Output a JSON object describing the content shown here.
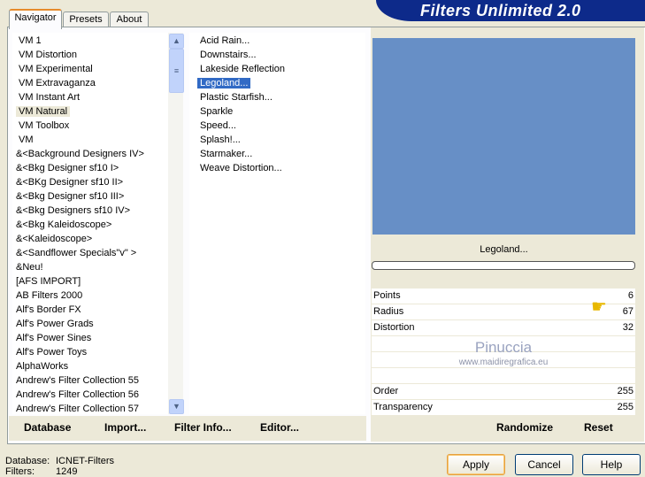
{
  "app_title": "Filters Unlimited 2.0",
  "tabs": [
    {
      "label": "Navigator"
    },
    {
      "label": "Presets"
    },
    {
      "label": "About"
    }
  ],
  "categories": [
    "VM 1",
    "VM Distortion",
    "VM Experimental",
    "VM Extravaganza",
    "VM Instant Art",
    "VM Natural",
    "VM Toolbox",
    "VM",
    "&<Background Designers IV>",
    "&<Bkg Designer sf10 I>",
    "&<BKg Designer sf10 II>",
    "&<Bkg Designer sf10 III>",
    "&<Bkg Designers sf10 IV>",
    "&<Bkg Kaleidoscope>",
    "&<Kaleidoscope>",
    "&<Sandflower Specials\"v\" >",
    "&Neu!",
    "[AFS IMPORT]",
    "AB Filters 2000",
    "Alf's Border FX",
    "Alf's Power Grads",
    "Alf's Power Sines",
    "Alf's Power Toys",
    "AlphaWorks",
    "Andrew's Filter Collection 55",
    "Andrew's Filter Collection 56",
    "Andrew's Filter Collection 57"
  ],
  "selected_category": "VM Natural",
  "filters": [
    "Acid Rain...",
    "Downstairs...",
    "Lakeside Reflection",
    "Legoland...",
    "Plastic Starfish...",
    "Sparkle",
    "Speed...",
    "Splash!...",
    "Starmaker...",
    "Weave Distortion..."
  ],
  "selected_filter": "Legoland...",
  "bottom_buttons": {
    "database": "Database",
    "import": "Import...",
    "filter_info": "Filter Info...",
    "editor": "Editor..."
  },
  "preview": {
    "color": "#678fc6",
    "filter_name": "Legoland...",
    "progress": 0
  },
  "params": [
    {
      "label": "Points",
      "value": "6"
    },
    {
      "label": "Radius",
      "value": "67"
    },
    {
      "label": "Distortion",
      "value": "32"
    },
    {
      "label": "",
      "value": ""
    },
    {
      "label": "",
      "value": ""
    },
    {
      "label": "",
      "value": ""
    },
    {
      "label": "Order",
      "value": "255"
    },
    {
      "label": "Transparency",
      "value": "255"
    }
  ],
  "watermark": {
    "name": "Pinuccia",
    "url": "www.maidiregrafica.eu"
  },
  "param_buttons": {
    "randomize": "Randomize",
    "reset": "Reset"
  },
  "status": {
    "database_label": "Database:",
    "database_value": "ICNET-Filters",
    "filters_label": "Filters:",
    "filters_value": "1249"
  },
  "dialog_buttons": {
    "apply": "Apply",
    "cancel": "Cancel",
    "help": "Help"
  }
}
